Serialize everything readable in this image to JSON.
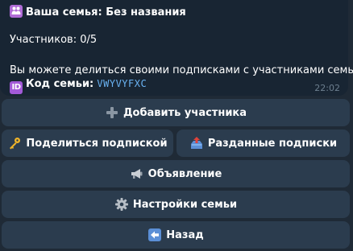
{
  "message": {
    "title": "Ваша семья: Без названия",
    "members": "Участников: 0/5",
    "description": "Вы можете делиться своими подписками с участниками семьи.",
    "code_label": "Код семьи:",
    "code_value": "VWYVYFXC",
    "time": "22:02",
    "icons": [
      "family-emoji-icon",
      "id-emoji-icon"
    ]
  },
  "keyboard": {
    "add_member": "Добавить участника",
    "share_subscription": "Поделиться подпиской",
    "shared_subscriptions": "Разданные подписки",
    "announcement": "Объявление",
    "family_settings": "Настройки семьи",
    "back": "Назад"
  },
  "colors": {
    "background": "#1f2a36",
    "bubble": "#182533",
    "button": "#2b3c4e",
    "code_link": "#6ab3f3",
    "timestamp": "#6d7f8f"
  }
}
